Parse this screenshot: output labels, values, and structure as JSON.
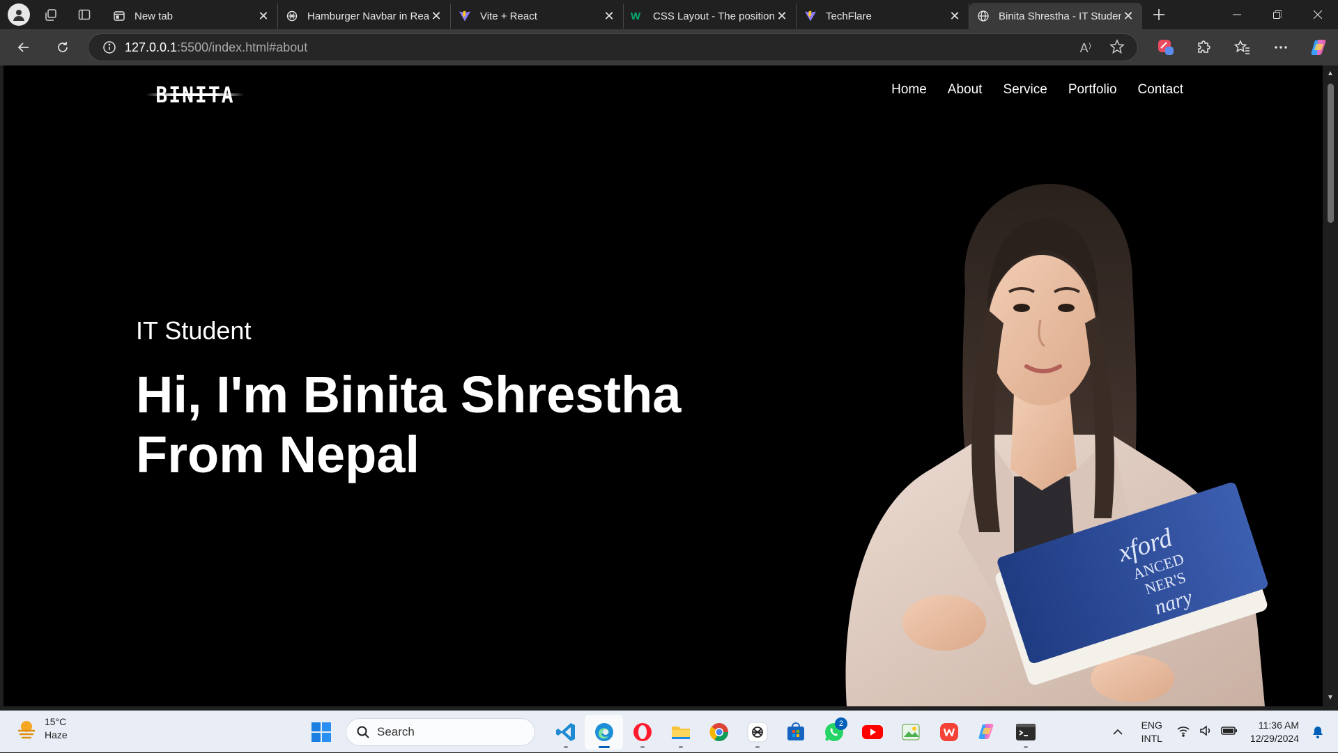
{
  "browser": {
    "tabs": [
      {
        "title": "New tab",
        "icon": "new-tab-icon",
        "active": false
      },
      {
        "title": "Hamburger Navbar in Rea",
        "icon": "chatgpt-icon",
        "active": false
      },
      {
        "title": "Vite + React",
        "icon": "vite-icon",
        "active": false
      },
      {
        "title": "CSS Layout - The position",
        "icon": "w3schools-icon",
        "active": false
      },
      {
        "title": "TechFlare",
        "icon": "vite-icon",
        "active": false
      },
      {
        "title": "Binita Shrestha - IT Studen",
        "icon": "globe-icon",
        "active": true
      }
    ],
    "url_host": "127.0.0.1",
    "url_rest": ":5500/index.html#about",
    "read_aloud_label": "A⁾"
  },
  "site": {
    "logo": "BINITA",
    "nav": [
      "Home",
      "About",
      "Service",
      "Portfolio",
      "Contact"
    ],
    "hero_subtitle": "IT Student",
    "hero_title_line1": "Hi, I'm Binita Shrestha",
    "hero_title_line2": "From Nepal",
    "book_text": [
      "xford",
      "ANCED",
      "NER'S",
      "nary"
    ]
  },
  "taskbar": {
    "weather_temp": "15°C",
    "weather_desc": "Haze",
    "search_placeholder": "Search",
    "whatsapp_badge": "2",
    "lang_line1": "ENG",
    "lang_line2": "INTL",
    "time": "11:36 AM",
    "date": "12/29/2024"
  },
  "colors": {
    "page_bg": "#000000",
    "chrome_bg": "#202020",
    "toolbar_bg": "#3a3a3a",
    "taskbar_bg": "#e9eef6",
    "accent": "#005fb8"
  }
}
